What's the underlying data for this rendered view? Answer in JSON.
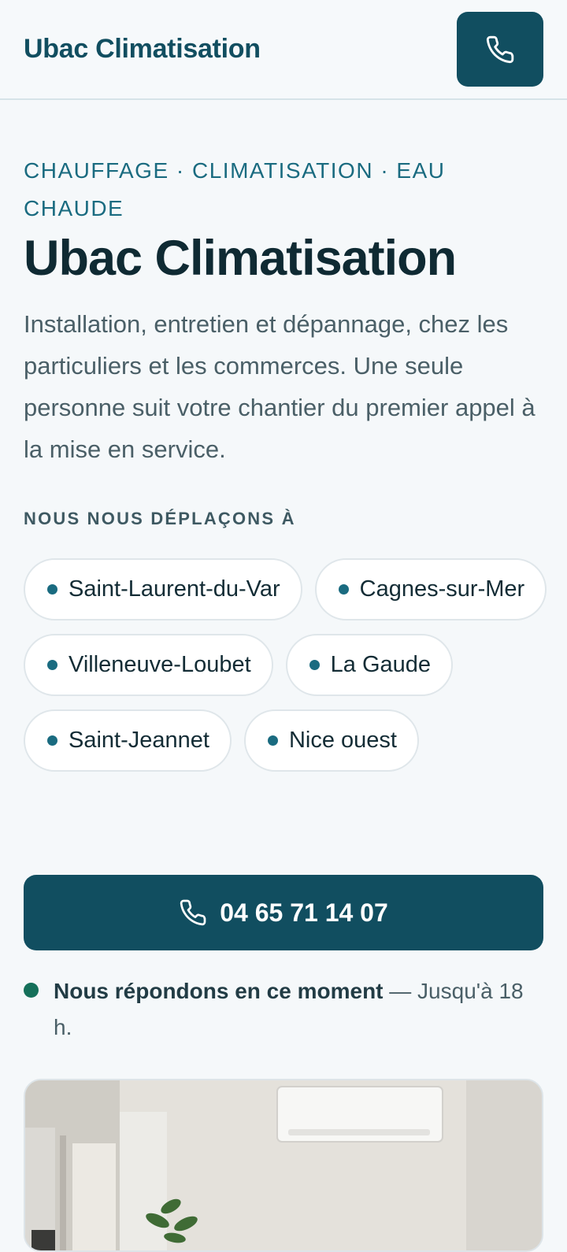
{
  "header": {
    "brand": "Ubac Climatisation",
    "call_icon": "phone-icon"
  },
  "hero": {
    "eyebrow": "Chauffage · Climatisation · Eau chaude",
    "title": "Ubac Climatisation",
    "lead": "Installation, entretien et dépannage, chez les particuliers et les commerces. Une seule personne suit votre chantier du premier appel à la mise en service."
  },
  "areas": {
    "label": "Nous nous déplaçons à",
    "items": [
      {
        "label": "Saint-Laurent-du-Var"
      },
      {
        "label": "Cagnes-sur-Mer"
      },
      {
        "label": "Villeneuve-Loubet"
      },
      {
        "label": "La Gaude"
      },
      {
        "label": "Saint-Jeannet"
      },
      {
        "label": "Nice ouest"
      }
    ]
  },
  "cta": {
    "icon": "phone-icon",
    "phone": "04 65 71 14 07"
  },
  "status": {
    "headline": "Nous répondons en ce moment",
    "detail": " — Jusqu'à 18 h."
  },
  "colors": {
    "brand": "#114e60",
    "accent": "#1a6b80",
    "live": "#15705a",
    "background": "#f5f8fa"
  }
}
